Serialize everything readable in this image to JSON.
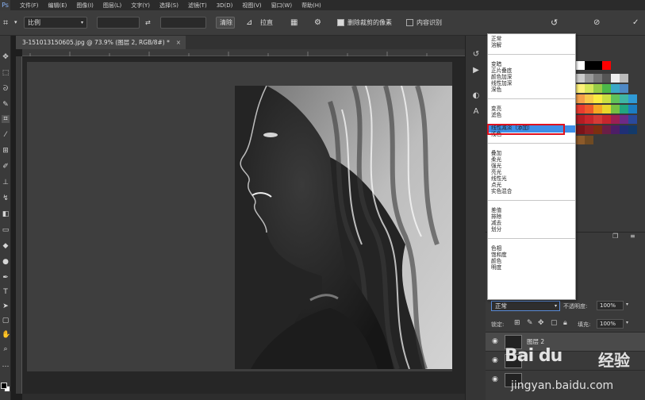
{
  "menubar": {
    "items": [
      "文件(F)",
      "编辑(E)",
      "图像(I)",
      "图层(L)",
      "文字(Y)",
      "选择(S)",
      "滤镜(T)",
      "3D(D)",
      "视图(V)",
      "窗口(W)",
      "帮助(H)"
    ]
  },
  "options": {
    "crop_ratio": "比例",
    "clear_label": "清除",
    "straighten_label": "拉直",
    "delete_cropped_label": "删除裁剪的像素",
    "delete_cropped_checked": true,
    "content_aware_label": "内容识别",
    "content_aware_checked": false
  },
  "document": {
    "tab_title": "3-1510131506​05.jpg @ 73.9% (图层 2, RGB/8#) *",
    "close": "×"
  },
  "blend_menu": {
    "groups": [
      [
        "正常",
        "溶解"
      ],
      [
        "变暗",
        "正片叠底",
        "颜色加深",
        "线性加深",
        "深色"
      ],
      [
        "变亮",
        "滤色",
        "颜色减淡",
        "线性减淡（添加）",
        "浅色"
      ],
      [
        "叠加",
        "柔光",
        "强光",
        "亮光",
        "线性光",
        "点光",
        "实色混合"
      ],
      [
        "差值",
        "排除",
        "减去",
        "划分"
      ],
      [
        "色相",
        "饱和度",
        "颜色",
        "明度"
      ]
    ],
    "selected": "颜色减淡",
    "highlight_color": "#3d8ee8",
    "annotation_color": "#e0121e"
  },
  "layers_panel": {
    "blend_mode": "正常",
    "opacity_label": "不透明度:",
    "opacity_value": "100%",
    "lock_label": "锁定:",
    "fill_label": "填充:",
    "fill_value": "100%",
    "layers": [
      {
        "name": "图层 2",
        "selected": true
      },
      {
        "name": "",
        "selected": false
      },
      {
        "name": "",
        "selected": false
      }
    ]
  },
  "watermark": {
    "logo": "Bai du",
    "cn": "经验",
    "url": "jingyan.baidu.com"
  }
}
